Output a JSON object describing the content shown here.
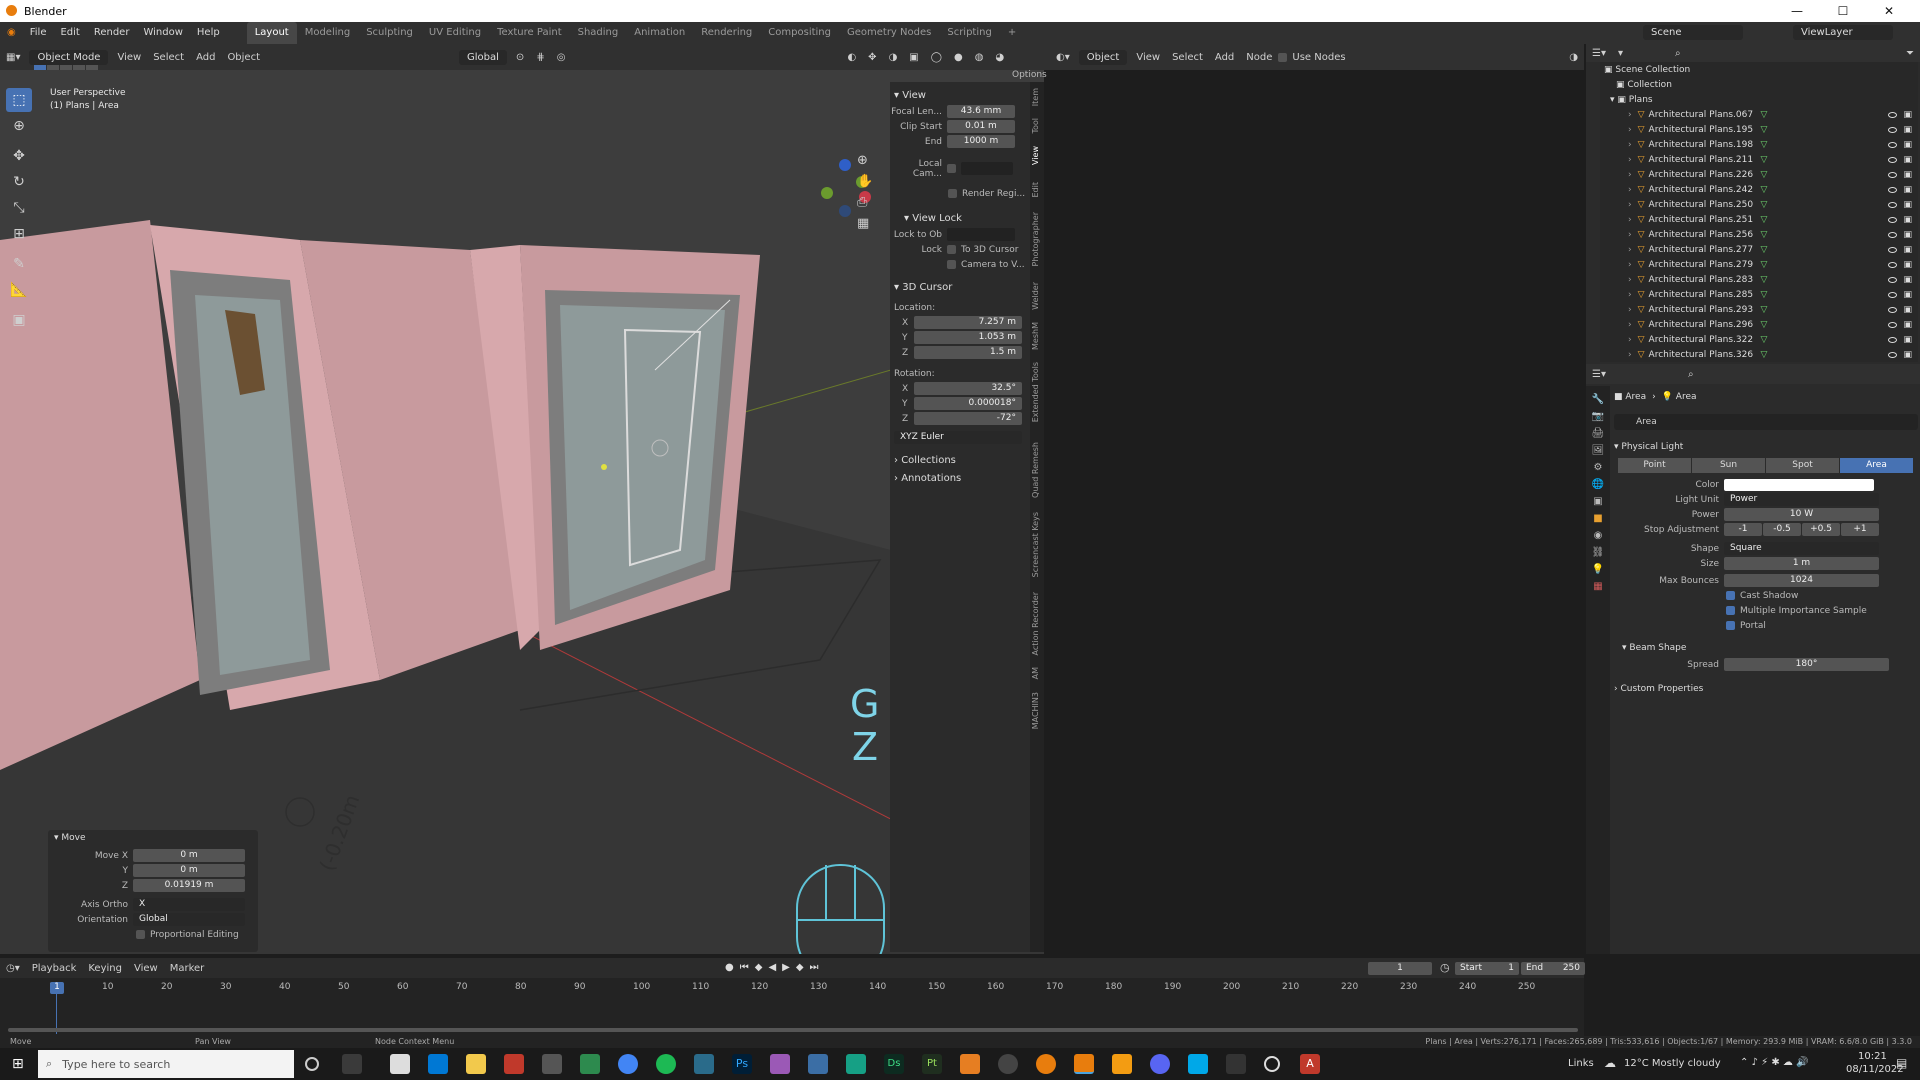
{
  "window": {
    "title": "Blender"
  },
  "menu": {
    "items": [
      "File",
      "Edit",
      "Render",
      "Window",
      "Help"
    ]
  },
  "workspaces": {
    "tabs": [
      "Layout",
      "Modeling",
      "Sculpting",
      "UV Editing",
      "Texture Paint",
      "Shading",
      "Animation",
      "Rendering",
      "Compositing",
      "Geometry Nodes",
      "Scripting"
    ],
    "active": "Layout"
  },
  "top_right": {
    "scene": "Scene",
    "viewlayer": "ViewLayer"
  },
  "viewport_header": {
    "mode": "Object Mode",
    "menus": [
      "View",
      "Select",
      "Add",
      "Object"
    ],
    "orientation": "Global",
    "options": "Options"
  },
  "viewport": {
    "perspective": "User Perspective",
    "context": "(1) Plans | Area",
    "key_g": "G",
    "key_z": "Z",
    "cursor_label": "(-0.20m"
  },
  "npanel": {
    "view_header": "View",
    "focal_label": "Focal Len...",
    "focal": "43.6 mm",
    "clip_start_label": "Clip Start",
    "clip_start": "0.01 m",
    "end_label": "End",
    "end": "1000 m",
    "local_cam": "Local Cam...",
    "render_region": "Render Regi...",
    "view_lock_header": "View Lock",
    "lock_to_obj": "Lock to Ob",
    "lock_label": "Lock",
    "to_3d_cursor": "To 3D Cursor",
    "camera_to_view": "Camera to V...",
    "cursor_header": "3D Cursor",
    "location_label": "Location:",
    "loc_x": "7.257 m",
    "loc_y": "1.053 m",
    "loc_z": "1.5 m",
    "rotation_label": "Rotation:",
    "rot_x": "32.5°",
    "rot_y": "0.000018°",
    "rot_z": "-72°",
    "rotation_mode": "XYZ Euler",
    "collections": "Collections",
    "annotations": "Annotations",
    "x": "X",
    "y": "Y",
    "z": "Z"
  },
  "vtabs": [
    "Item",
    "Tool",
    "View",
    "Edit",
    "Photographer",
    "Welder",
    "MeshM",
    "Extended Tools",
    "Quad Remesh",
    "Screencast Keys",
    "Action Recorder",
    "AM",
    "MACHIN3"
  ],
  "move_panel": {
    "title": "Move",
    "move_x_label": "Move X",
    "move_x": "0 m",
    "y_label": "Y",
    "y": "0 m",
    "z_label": "Z",
    "z": "0.01919 m",
    "axis_ortho_label": "Axis Ortho",
    "axis_ortho": "X",
    "orientation_label": "Orientation",
    "orientation": "Global",
    "proportional": "Proportional Editing"
  },
  "node_editor": {
    "type": "Object",
    "menus": [
      "View",
      "Select",
      "Add",
      "Node"
    ],
    "use_nodes": "Use Nodes"
  },
  "outliner": {
    "scene_collection": "Scene Collection",
    "collection": "Collection",
    "plans": "Plans",
    "items": [
      "Architectural Plans.067",
      "Architectural Plans.195",
      "Architectural Plans.198",
      "Architectural Plans.211",
      "Architectural Plans.226",
      "Architectural Plans.242",
      "Architectural Plans.250",
      "Architectural Plans.251",
      "Architectural Plans.256",
      "Architectural Plans.277",
      "Architectural Plans.279",
      "Architectural Plans.283",
      "Architectural Plans.285",
      "Architectural Plans.293",
      "Architectural Plans.296",
      "Architectural Plans.322",
      "Architectural Plans.326"
    ]
  },
  "properties": {
    "breadcrumb_obj": "Area",
    "breadcrumb_data": "Area",
    "datablock": "Area",
    "physical_light": "Physical Light",
    "light_types": [
      "Point",
      "Sun",
      "Spot",
      "Area"
    ],
    "active_type": "Area",
    "color_label": "Color",
    "light_unit_label": "Light Unit",
    "light_unit": "Power",
    "power_label": "Power",
    "power": "10 W",
    "stop_label": "Stop Adjustment",
    "stops": [
      "-1",
      "-0.5",
      "+0.5",
      "+1"
    ],
    "shape_label": "Shape",
    "shape": "Square",
    "size_label": "Size",
    "size": "1 m",
    "max_bounces_label": "Max Bounces",
    "max_bounces": "1024",
    "cast_shadow": "Cast Shadow",
    "mis": "Multiple Importance Sample",
    "portal": "Portal",
    "beam_shape": "Beam Shape",
    "spread_label": "Spread",
    "spread": "180°",
    "custom_props": "Custom Properties"
  },
  "timeline": {
    "menus": [
      "Playback",
      "Keying",
      "View",
      "Marker"
    ],
    "current_frame": "1",
    "start_label": "Start",
    "start": "1",
    "end_label": "End",
    "end": "250",
    "ticks": [
      "1",
      "10",
      "20",
      "30",
      "40",
      "50",
      "60",
      "70",
      "80",
      "90",
      "100",
      "110",
      "120",
      "130",
      "140",
      "150",
      "160",
      "170",
      "180",
      "190",
      "200",
      "210",
      "220",
      "230",
      "240",
      "250"
    ]
  },
  "status": {
    "left": "Move",
    "mid": "Pan View",
    "mid2": "Node Context Menu",
    "right": "Plans | Area | Verts:276,171 | Faces:265,689 | Tris:533,616 | Objects:1/67 | Memory: 293.9 MiB | VRAM: 6.6/8.0 GiB | 3.3.0"
  },
  "taskbar": {
    "search_placeholder": "Type here to search",
    "links": "Links",
    "weather": "12°C  Mostly cloudy",
    "time": "10:21",
    "date": "08/11/2022"
  },
  "colors": {
    "accent": "#4772b3",
    "wall": "#c89a9e",
    "keyhint": "#7fd4e8"
  }
}
